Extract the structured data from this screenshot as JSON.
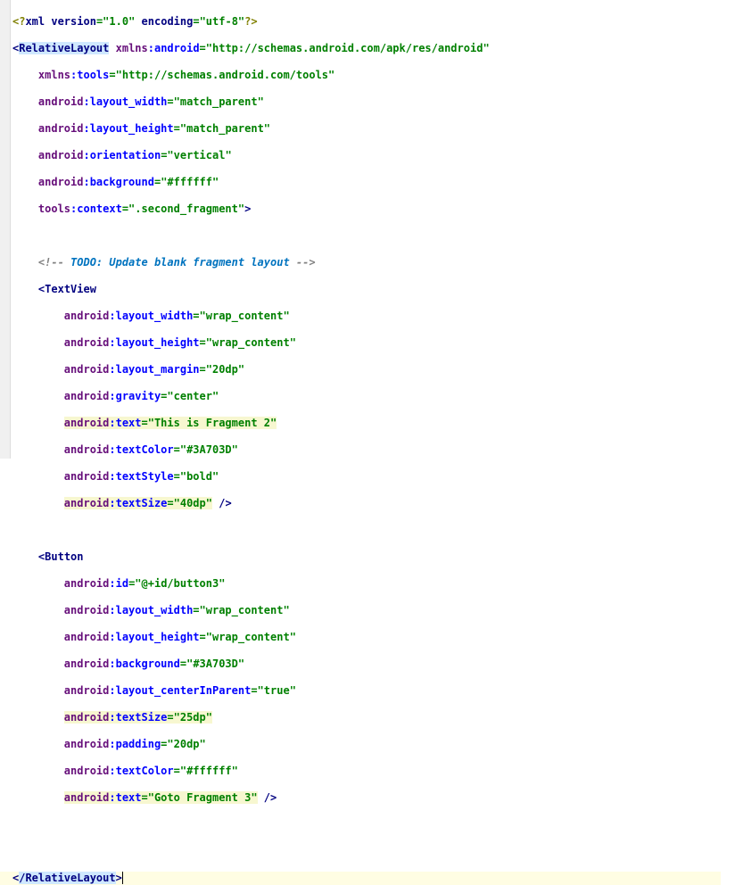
{
  "xml_decl": {
    "version": "1.0",
    "encoding": "utf-8"
  },
  "root": {
    "tag": "RelativeLayout",
    "ns_android_attr": "xmlns:android",
    "ns_android_val": "http://schemas.android.com/apk/res/android",
    "ns_tools_attr": "xmlns:tools",
    "ns_tools_val": "http://schemas.android.com/tools",
    "layout_width_attr": "android:layout_width",
    "layout_width_val": "match_parent",
    "layout_height_attr": "android:layout_height",
    "layout_height_val": "match_parent",
    "orientation_attr": "android:orientation",
    "orientation_val": "vertical",
    "background_attr": "android:background",
    "background_val": "#ffffff",
    "context_attr": "tools:context",
    "context_val": ".second_fragment",
    "close_tag": "/RelativeLayout"
  },
  "comment": {
    "prefix": "<!-- ",
    "todo": "TODO: Update blank fragment layout",
    "suffix": " -->"
  },
  "textview": {
    "tag": "TextView",
    "lw_attr": "android:layout_width",
    "lw_val": "wrap_content",
    "lh_attr": "android:layout_height",
    "lh_val": "wrap_content",
    "margin_attr": "android:layout_margin",
    "margin_val": "20dp",
    "gravity_attr": "android:gravity",
    "gravity_val": "center",
    "text_attr": "android:text",
    "text_val": "This is Fragment 2",
    "tc_attr": "android:textColor",
    "tc_val": "#3A703D",
    "ts_attr": "android:textStyle",
    "ts_val": "bold",
    "tsize_attr": "android:textSize",
    "tsize_val": "40dp"
  },
  "button": {
    "tag": "Button",
    "id_attr": "android:id",
    "id_val": "@+id/button3",
    "lw_attr": "android:layout_width",
    "lw_val": "wrap_content",
    "lh_attr": "android:layout_height",
    "lh_val": "wrap_content",
    "bg_attr": "android:background",
    "bg_val": "#3A703D",
    "center_attr": "android:layout_centerInParent",
    "center_val": "true",
    "tsize_attr": "android:textSize",
    "tsize_val": "25dp",
    "pad_attr": "android:padding",
    "pad_val": "20dp",
    "tc_attr": "android:textColor",
    "tc_val": "#ffffff",
    "text_attr": "android:text",
    "text_val": "Goto Fragment 3"
  }
}
